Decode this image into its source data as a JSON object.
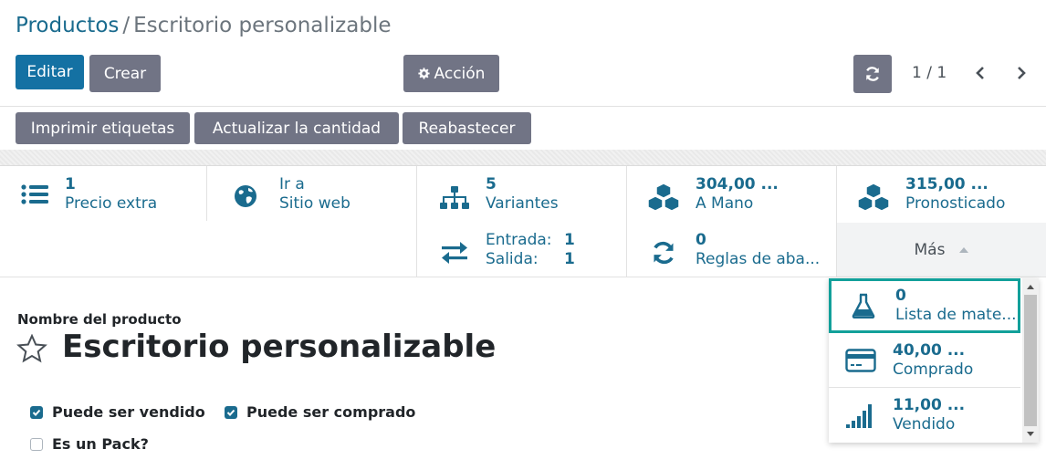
{
  "breadcrumb": {
    "parent": "Productos",
    "separator": "/",
    "current": "Escritorio personalizable"
  },
  "toolbar": {
    "edit": "Editar",
    "create": "Crear",
    "action": "Acción",
    "pager": "1 / 1"
  },
  "header_buttons": {
    "print": "Imprimir etiquetas",
    "update_qty": "Actualizar la cantidad",
    "replenish": "Reabastecer"
  },
  "smart_buttons": {
    "extra_price": {
      "value": "1",
      "label": "Precio extra"
    },
    "website": {
      "value": "Ir a",
      "label": "Sitio web"
    },
    "variants": {
      "value": "5",
      "label": "Variantes"
    },
    "on_hand": {
      "value": "304,00 ...",
      "label": "A Mano"
    },
    "forecast": {
      "value": "315,00 ...",
      "label": "Pronosticado"
    },
    "in_out": {
      "in_label": "Entrada:",
      "in_value": "1",
      "out_label": "Salida:",
      "out_value": "1"
    },
    "reorder": {
      "value": "0",
      "label": "Reglas de aba..."
    },
    "more": "Más"
  },
  "dropdown": [
    {
      "value": "0",
      "label": "Lista de mate..."
    },
    {
      "value": "40,00 ...",
      "label": "Comprado"
    },
    {
      "value": "11,00 ...",
      "label": "Vendido"
    }
  ],
  "form": {
    "name_label": "Nombre del producto",
    "name": "Escritorio personalizable",
    "can_be_sold": {
      "label": "Puede ser vendido",
      "checked": true
    },
    "can_be_purchased": {
      "label": "Puede ser comprado",
      "checked": true
    },
    "is_pack": {
      "label": "Es un Pack?",
      "checked": false
    }
  },
  "colors": {
    "primary": "#1471a3",
    "secondary": "#717485",
    "link": "#1a6b8e",
    "focus": "#12a09a"
  },
  "icons": [
    "list-icon",
    "globe-icon",
    "sitemap-icon",
    "cubes-icon",
    "exchange-icon",
    "refresh-icon",
    "flask-icon",
    "credit-card-icon",
    "signal-icon",
    "star-icon",
    "cog-icon",
    "chevron-left-icon",
    "chevron-right-icon"
  ]
}
